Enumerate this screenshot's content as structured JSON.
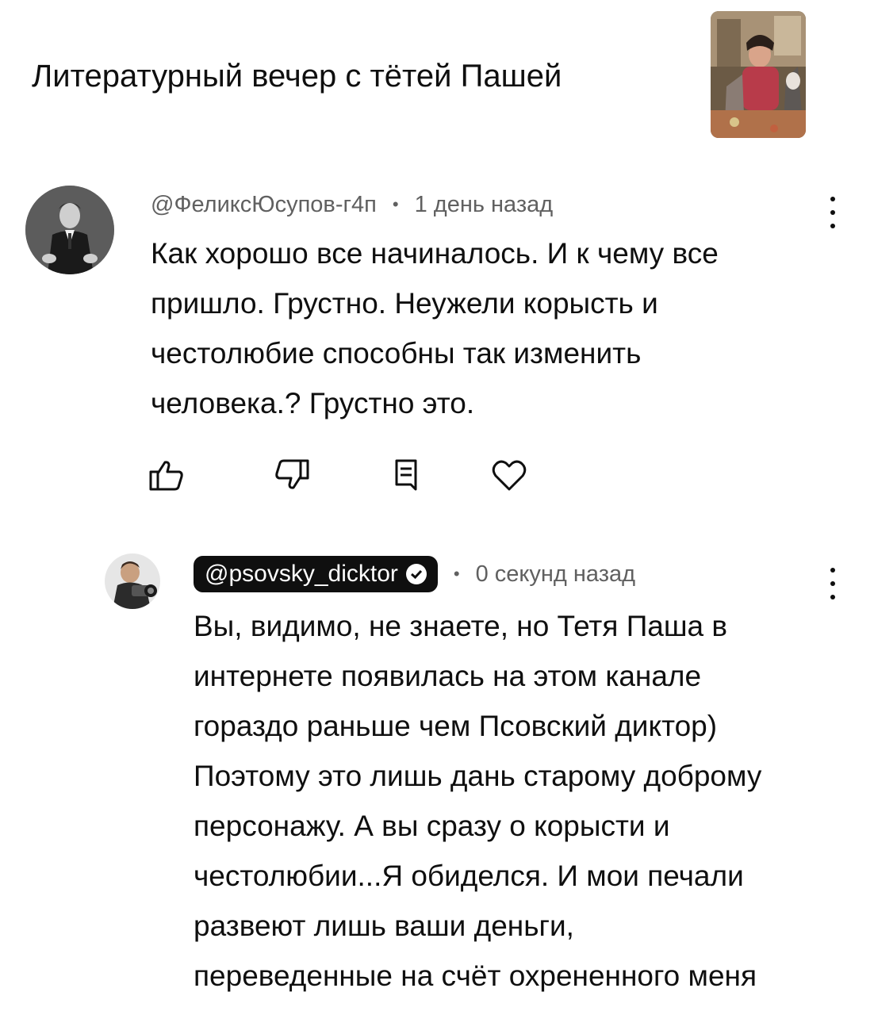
{
  "video": {
    "title": "Литературный вечер с тётей Пашей",
    "thumbnail_icon": "video-thumbnail"
  },
  "comments": [
    {
      "author": "@ФеликсЮсупов-г4п",
      "separator": "•",
      "time": "1 день назад",
      "text": "Как хорошо все начиналось.  И к чему все\nпришло.   Грустно.   Неужели корысть и\nчестолюбие способны  так изменить\nчеловека.? Грустно это.",
      "actions": [
        "like-icon",
        "dislike-icon",
        "reply-icon",
        "heart-icon"
      ]
    },
    {
      "author": "@psovsky_dicktor",
      "verified": true,
      "separator": "•",
      "time": "0 секунд назад",
      "text": "Вы, видимо, не знаете, но Тетя Паша в\nинтернете появилась на этом канале\nгораздо раньше чем Псовский диктор)\nПоэтому это лишь дань старому доброму\nперсонажу. А вы сразу о корысти и\nчестолюбии...Я обиделся. И мои печали\nразвеют лишь ваши деньги,\nпереведенные на счёт охрененного меня"
    }
  ],
  "colors": {
    "text": "#0f0f0f",
    "meta": "#606060",
    "chip_bg": "#0f0f0f",
    "background": "#ffffff"
  }
}
